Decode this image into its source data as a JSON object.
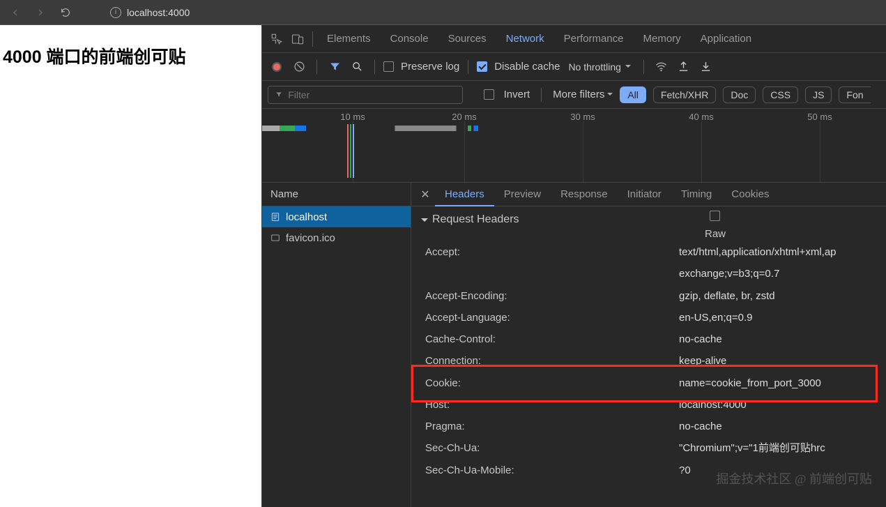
{
  "browser": {
    "url": "localhost:4000"
  },
  "page": {
    "heading": "4000 端口的前端创可贴"
  },
  "devtools": {
    "tabs": [
      "Elements",
      "Console",
      "Sources",
      "Network",
      "Performance",
      "Memory",
      "Application"
    ],
    "active_tab": "Network"
  },
  "net_toolbar": {
    "preserve_log_label": "Preserve log",
    "disable_cache_label": "Disable cache",
    "throttling_label": "No throttling"
  },
  "filter_bar": {
    "placeholder": "Filter",
    "invert_label": "Invert",
    "more_filters_label": "More filters",
    "pills": [
      "All",
      "Fetch/XHR",
      "Doc",
      "CSS",
      "JS",
      "Fon"
    ],
    "active_pill": "All"
  },
  "timeline": {
    "ticks": [
      "10 ms",
      "20 ms",
      "30 ms",
      "40 ms",
      "50 ms"
    ]
  },
  "requests": {
    "header": "Name",
    "items": [
      {
        "name": "localhost",
        "selected": true,
        "icon": "doc"
      },
      {
        "name": "favicon.ico",
        "selected": false,
        "icon": "img"
      }
    ]
  },
  "detail_tabs": [
    "Headers",
    "Preview",
    "Response",
    "Initiator",
    "Timing",
    "Cookies"
  ],
  "detail_active": "Headers",
  "headers_section": {
    "title": "Request Headers",
    "raw_label": "Raw",
    "rows": [
      {
        "k": "Accept:",
        "v": "text/html,application/xhtml+xml,ap"
      },
      {
        "k": "",
        "v": "exchange;v=b3;q=0.7"
      },
      {
        "k": "Accept-Encoding:",
        "v": "gzip, deflate, br, zstd"
      },
      {
        "k": "Accept-Language:",
        "v": "en-US,en;q=0.9"
      },
      {
        "k": "Cache-Control:",
        "v": "no-cache"
      },
      {
        "k": "Connection:",
        "v": "keep-alive"
      },
      {
        "k": "Cookie:",
        "v": "name=cookie_from_port_3000"
      },
      {
        "k": "Host:",
        "v": "localhost:4000"
      },
      {
        "k": "Pragma:",
        "v": "no-cache"
      },
      {
        "k": "Sec-Ch-Ua:",
        "v": "\"Chromium\";v=\"1前端创可贴hrc"
      },
      {
        "k": "Sec-Ch-Ua-Mobile:",
        "v": "?0"
      }
    ]
  },
  "watermark": "掘金技术社区 @ 前端创可贴"
}
